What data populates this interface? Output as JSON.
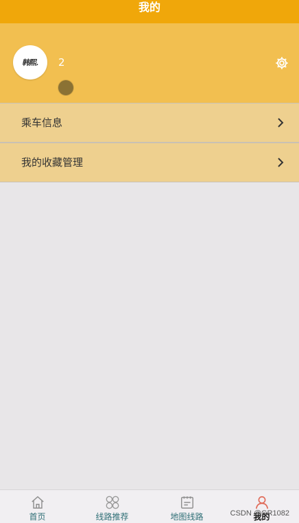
{
  "header": {
    "title": "我的"
  },
  "profile": {
    "avatar_text": "韩熙.",
    "count": "2",
    "settings_icon": "gear-icon"
  },
  "menu": [
    {
      "label": "乘车信息",
      "icon": "chevron-right-icon"
    },
    {
      "label": "我的收藏管理",
      "icon": "chevron-right-icon"
    }
  ],
  "tabs": [
    {
      "label": "首页",
      "icon": "home-icon",
      "active": false
    },
    {
      "label": "线路推荐",
      "icon": "grid-circles-icon",
      "active": false
    },
    {
      "label": "地图线路",
      "icon": "map-card-icon",
      "active": false
    },
    {
      "label": "我的",
      "icon": "user-icon",
      "active": true
    }
  ],
  "watermark": "CSDN @GR1082",
  "colors": {
    "title_bar": "#f0a70a",
    "profile_bg": "#f2bf50",
    "menu_bg": "#eed08f",
    "page_bg": "#e8e6e8",
    "tab_text": "#2f6f76",
    "active_icon": "#e06a58"
  }
}
